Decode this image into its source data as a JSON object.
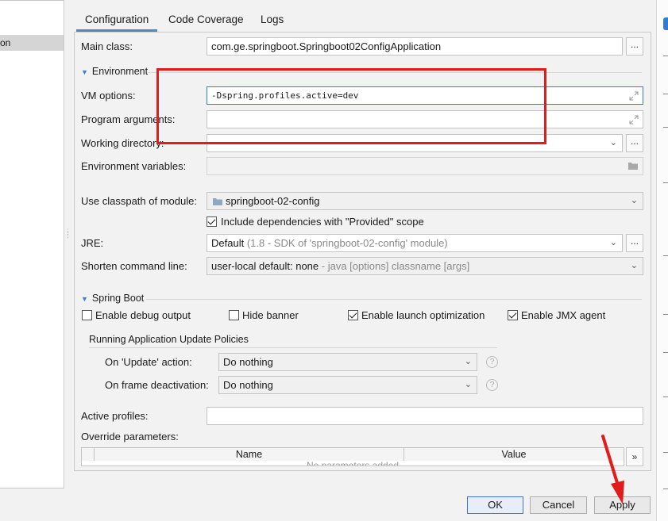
{
  "left_panel": {
    "selected_item": "on"
  },
  "tabs": [
    "Configuration",
    "Code Coverage",
    "Logs"
  ],
  "main_class": {
    "label": "Main class:",
    "value": "com.ge.springboot.Springboot02ConfigApplication",
    "browse": "..."
  },
  "environment": {
    "header": "Environment",
    "vm_options": {
      "label": "VM options:",
      "value": "-Dspring.profiles.active=dev"
    },
    "program_arguments": {
      "label": "Program arguments:",
      "value": ""
    },
    "working_directory": {
      "label": "Working directory:",
      "value": "",
      "browse": "..."
    },
    "environment_variables": {
      "label": "Environment variables:",
      "value": ""
    }
  },
  "classpath": {
    "label": "Use classpath of module:",
    "value": "springboot-02-config"
  },
  "include_provided": {
    "label": "Include dependencies with \"Provided\" scope",
    "checked": true
  },
  "jre": {
    "label": "JRE:",
    "value_main": "Default",
    "value_detail": "(1.8 - SDK of 'springboot-02-config' module)",
    "browse": "..."
  },
  "shorten_cmd": {
    "label": "Shorten command line:",
    "value_main": "user-local default: none",
    "value_detail": " - java [options] classname [args]"
  },
  "spring_boot": {
    "header": "Spring Boot",
    "options": [
      {
        "label": "Enable debug output",
        "checked": false
      },
      {
        "label": "Hide banner",
        "checked": false
      },
      {
        "label": "Enable launch optimization",
        "checked": true
      },
      {
        "label": "Enable JMX agent",
        "checked": true
      }
    ],
    "update_policies": {
      "header": "Running Application Update Policies",
      "on_update": {
        "label": "On 'Update' action:",
        "value": "Do nothing"
      },
      "on_frame": {
        "label": "On frame deactivation:",
        "value": "Do nothing"
      },
      "help": "?"
    }
  },
  "active_profiles": {
    "label": "Active profiles:",
    "value": ""
  },
  "override_parameters": {
    "label": "Override parameters:",
    "columns": [
      "Name",
      "Value"
    ],
    "empty_text": "No parameters added",
    "more": "»"
  },
  "buttons": {
    "ok": "OK",
    "cancel": "Cancel",
    "apply": "Apply"
  },
  "colors": {
    "accent": "#4a88c7",
    "annotation": "#e21b1b",
    "panel_bg": "#f2f2f2"
  }
}
